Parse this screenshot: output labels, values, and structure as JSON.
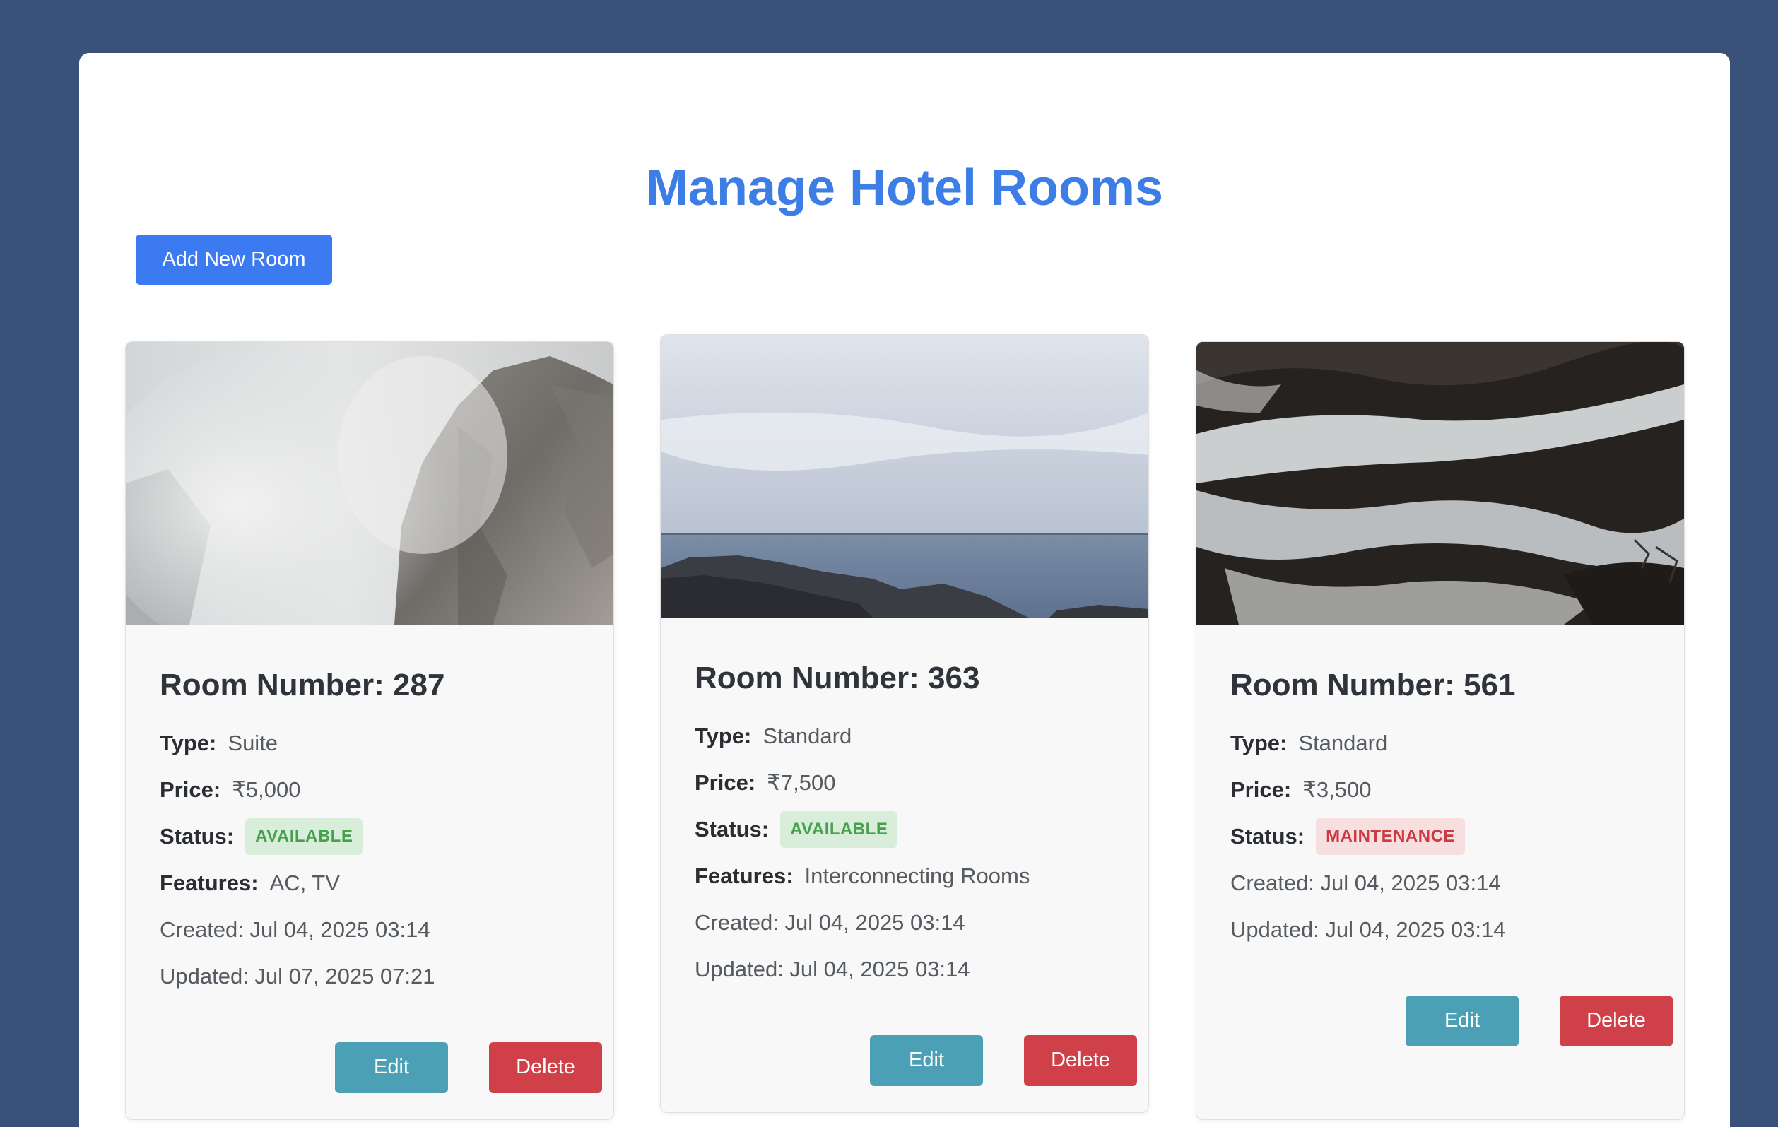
{
  "page": {
    "title": "Manage Hotel Rooms",
    "add_button_label": "Add New Room"
  },
  "labels": {
    "type": "Type:",
    "price": "Price:",
    "status": "Status:",
    "features": "Features:",
    "edit": "Edit",
    "delete": "Delete"
  },
  "rooms": [
    {
      "room_number": "Room Number: 287",
      "type": "Suite",
      "price": "₹5,000",
      "status": "AVAILABLE",
      "features": "AC, TV",
      "created": "Created: Jul 04, 2025 03:14",
      "updated": "Updated: Jul 07, 2025 07:21"
    },
    {
      "room_number": "Room Number: 363",
      "type": "Standard",
      "price": "₹7,500",
      "status": "AVAILABLE",
      "features": "Interconnecting Rooms",
      "created": "Created: Jul 04, 2025 03:14",
      "updated": "Updated: Jul 04, 2025 03:14"
    },
    {
      "room_number": "Room Number: 561",
      "type": "Standard",
      "price": "₹3,500",
      "status": "MAINTENANCE",
      "created": "Created: Jul 04, 2025 03:14",
      "updated": "Updated: Jul 04, 2025 03:14"
    }
  ],
  "colors": {
    "background": "#3a5179",
    "title": "#3d7ee6",
    "primary_button": "#3b7af0",
    "edit_button": "#4ca0b5",
    "delete_button": "#cf4048",
    "available_badge": "#46a04d",
    "maintenance_badge": "#cc3a43"
  }
}
